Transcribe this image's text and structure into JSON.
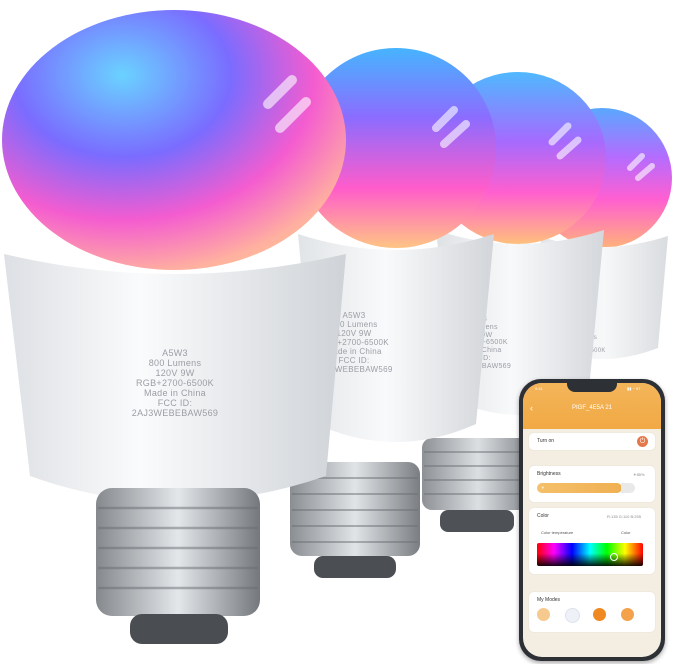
{
  "bulbs": [
    {
      "id": "bulb1",
      "text": [
        "A5W3",
        "800 Lumens",
        "120V 9W",
        "RGB+2700-6500K",
        "Made in China",
        "FCC ID:",
        "2AJ3WEBEBAW569"
      ]
    },
    {
      "id": "bulb2",
      "text": [
        "A5W3",
        "800 Lumens",
        "120V 9W",
        "RGB+2700-6500K",
        "Made in China",
        "FCC ID:",
        "2AJ3WEBEBAW569"
      ]
    },
    {
      "id": "bulb3",
      "text": [
        "A5W3",
        "800 Lumens",
        "120V 9W",
        "RGB+2700-6500K",
        "Made in China",
        "FCC ID:",
        "2AJ3WEBEBAW569"
      ]
    },
    {
      "id": "bulb4",
      "text": [
        "A5W3",
        "800 Lumens",
        "120V 9W",
        "RGB+2700-6500K"
      ]
    }
  ],
  "phone": {
    "status_time": "9:41",
    "status_icons": "▮▮ ◔ 97",
    "device_title": "PIGF_4E5A 21",
    "back_glyph": "‹",
    "turn_on_label": "Turn on",
    "power_glyph": "⏻",
    "brightness_label": "Brightness",
    "brightness_value": "☀85%",
    "brightness_level": 0.85,
    "color_label": "Color",
    "color_value": "R:135 G:110 B:255",
    "tab_color_temperature": "Color temperature",
    "tab_color": "Color",
    "my_modes_label": "My Modes",
    "mode_colors": [
      "#f6c98f",
      "#eef1f8",
      "#ef8a22",
      "#f3a24b"
    ]
  },
  "colors": {
    "accent_orange": "#f1a944",
    "bulb_base": "#eceef0"
  }
}
